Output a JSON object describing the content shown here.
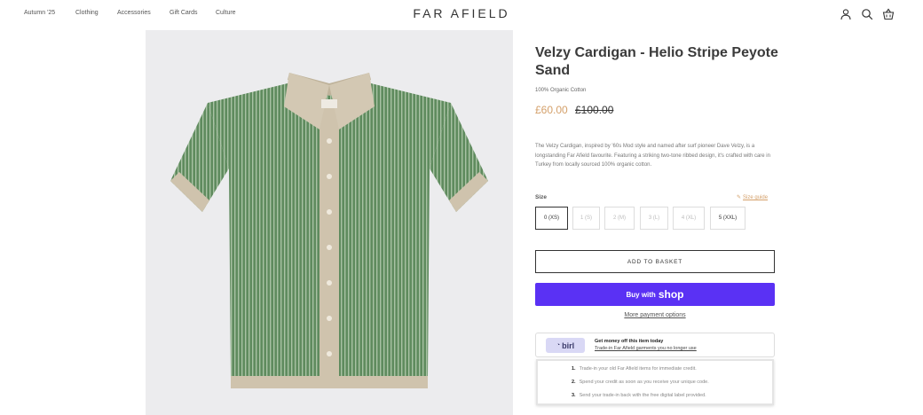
{
  "header": {
    "nav": [
      "Autumn '25",
      "Clothing",
      "Accessories",
      "Gift Cards",
      "Culture"
    ],
    "logo": "FAR AFIELD",
    "icons": [
      "account-icon",
      "search-icon",
      "basket-icon"
    ]
  },
  "product": {
    "title": "Velzy Cardigan - Helio Stripe Peyote Sand",
    "material": "100% Organic Cotton",
    "price": "£60.00",
    "compare_price": "£100.00",
    "description": "The Velzy Cardigan, inspired by '60s Mod style and named after surf pioneer Dave Velzy, is a longstanding Far Afield favourite. Featuring a striking two-tone ribbed design, it's crafted with care in Turkey from locally sourced 100% organic cotton.",
    "size_label": "Size",
    "size_guide": "Size guide",
    "sizes": [
      {
        "label": "0 (XS)",
        "state": "selected"
      },
      {
        "label": "1 (S)",
        "state": "unavailable"
      },
      {
        "label": "2 (M)",
        "state": "unavailable"
      },
      {
        "label": "3 (L)",
        "state": "unavailable"
      },
      {
        "label": "4 (XL)",
        "state": "unavailable"
      },
      {
        "label": "5 (XXL)",
        "state": "available"
      }
    ],
    "add_to_basket": "ADD TO BASKET",
    "buy_with": "Buy with",
    "shop": "shop",
    "more_payment": "More payment options"
  },
  "birl": {
    "logo": "birl",
    "headline": "Get money off this item today",
    "subline": "Trade-in Far Afield garments you no longer use",
    "steps": [
      {
        "num": "1.",
        "text": "Trade-in your old Far Afield items for immediate credit."
      },
      {
        "num": "2.",
        "text": "Spend your credit as soon as you receive your unique code."
      },
      {
        "num": "3.",
        "text": "Send your trade-in back with the free digital label provided."
      }
    ]
  },
  "colors": {
    "accent_price": "#d4a06a",
    "shop_pay": "#5a31f4",
    "garment_green": "#5d8a5c",
    "garment_trim": "#cfc3ad"
  }
}
